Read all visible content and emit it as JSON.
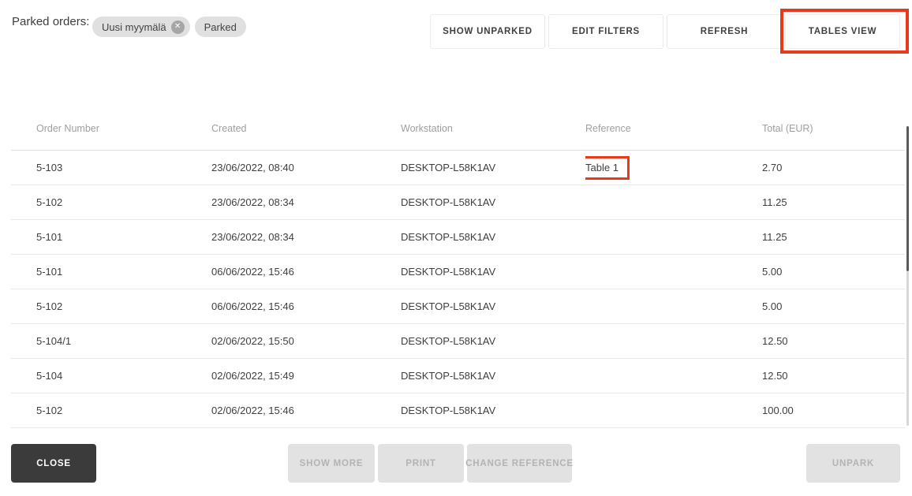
{
  "header": {
    "label": "Parked orders:",
    "filters": [
      {
        "label": "Uusi myymälä",
        "removable": true
      },
      {
        "label": "Parked",
        "removable": false
      }
    ],
    "buttons": [
      "SHOW UNPARKED",
      "EDIT FILTERS",
      "REFRESH",
      "TABLES VIEW"
    ],
    "close_icon": "✕"
  },
  "table": {
    "columns": [
      "Order Number",
      "Created",
      "Workstation",
      "Reference",
      "Total (EUR)"
    ],
    "rows": [
      [
        "5-103",
        "23/06/2022, 08:40",
        "DESKTOP-L58K1AV",
        "Table 1",
        "2.70"
      ],
      [
        "5-102",
        "23/06/2022, 08:34",
        "DESKTOP-L58K1AV",
        "",
        "11.25"
      ],
      [
        "5-101",
        "23/06/2022, 08:34",
        "DESKTOP-L58K1AV",
        "",
        "11.25"
      ],
      [
        "5-101",
        "06/06/2022, 15:46",
        "DESKTOP-L58K1AV",
        "",
        "5.00"
      ],
      [
        "5-102",
        "06/06/2022, 15:46",
        "DESKTOP-L58K1AV",
        "",
        "5.00"
      ],
      [
        "5-104/1",
        "02/06/2022, 15:50",
        "DESKTOP-L58K1AV",
        "",
        "12.50"
      ],
      [
        "5-104",
        "02/06/2022, 15:49",
        "DESKTOP-L58K1AV",
        "",
        "12.50"
      ],
      [
        "5-102",
        "02/06/2022, 15:46",
        "DESKTOP-L58K1AV",
        "",
        "100.00"
      ]
    ]
  },
  "footer": {
    "close": "CLOSE",
    "show_more": "SHOW MORE",
    "print": "PRINT",
    "change_reference": "CHANGE REFERENCE",
    "unpark": "UNPARK"
  },
  "annotations": {
    "color": "#e8391d",
    "highlighted_button": "TABLES VIEW",
    "cell": {
      "row": 0,
      "col": 3
    }
  }
}
